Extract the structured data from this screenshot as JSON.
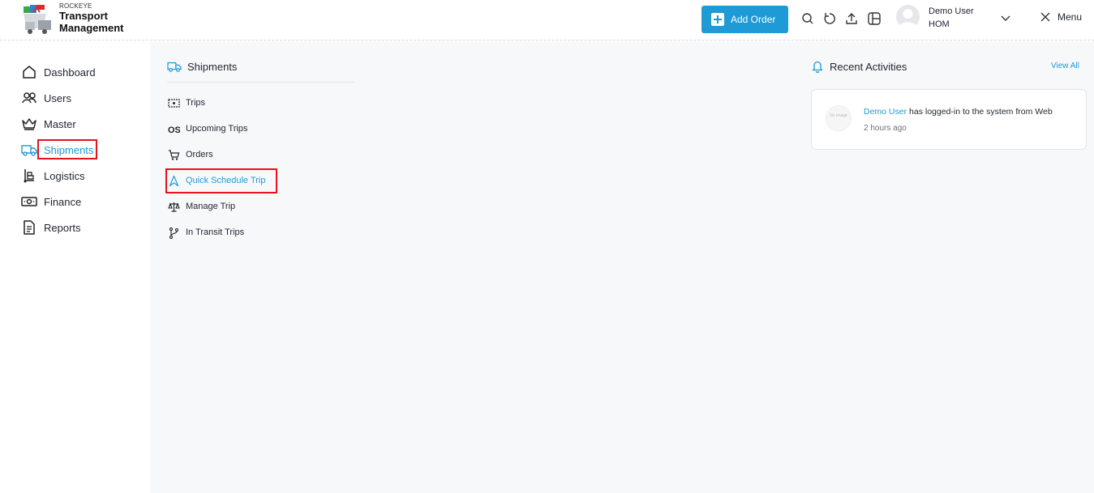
{
  "brand": {
    "top": "ROCKEYE",
    "line1": "Transport",
    "line2": "Management"
  },
  "header": {
    "add_order_label": "Add Order",
    "icons": [
      "search-icon",
      "refresh-icon",
      "upload-icon",
      "layout-icon"
    ],
    "user_name": "Demo User",
    "user_role": "HOM",
    "menu_label": "Menu"
  },
  "sidebar": {
    "items": [
      {
        "label": "Dashboard",
        "icon": "home-icon"
      },
      {
        "label": "Users",
        "icon": "users-icon"
      },
      {
        "label": "Master",
        "icon": "crown-icon"
      },
      {
        "label": "Shipments",
        "icon": "truck-icon",
        "active": true
      },
      {
        "label": "Logistics",
        "icon": "logistics-icon"
      },
      {
        "label": "Finance",
        "icon": "money-icon"
      },
      {
        "label": "Reports",
        "icon": "report-icon"
      }
    ]
  },
  "submenu": {
    "title": "Shipments",
    "items": [
      {
        "label": "Trips",
        "icon": "trip-icon"
      },
      {
        "label": "Upcoming Trips",
        "icon": "os-icon"
      },
      {
        "label": "Orders",
        "icon": "cart-icon"
      },
      {
        "label": "Quick Schedule Trip",
        "icon": "navigation-icon",
        "active": true
      },
      {
        "label": "Manage Trip",
        "icon": "scale-icon"
      },
      {
        "label": "In Transit Trips",
        "icon": "branch-icon"
      }
    ]
  },
  "activities": {
    "title": "Recent Activities",
    "view_all": "View All",
    "items": [
      {
        "user": "Demo User",
        "text": " has logged-in to the system from Web",
        "time": "2 hours ago",
        "image_text": "No Image"
      }
    ]
  },
  "colors": {
    "accent": "#1e9ad6",
    "highlight": "#e4141b",
    "background": "#f7f8fa"
  }
}
